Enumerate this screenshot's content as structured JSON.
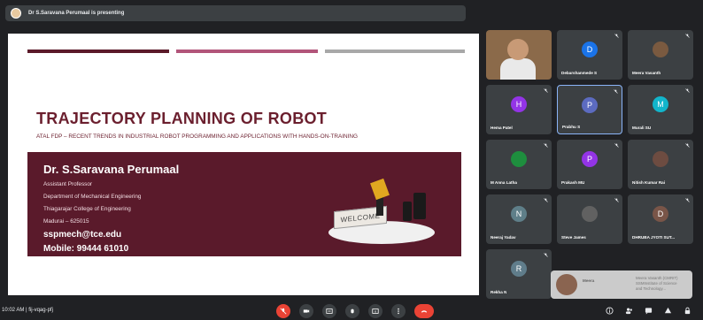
{
  "topbar": {
    "presenting_text": "Dr S.Saravana Perumaal is presenting"
  },
  "slide": {
    "bar_colors": [
      "#5b1a2a",
      "#b2557a",
      "#a8a8a8"
    ],
    "title": "TRAJECTORY PLANNING OF ROBOT",
    "subtitle": "ATAL FDP – RECENT TRENDS IN INDUSTRIAL ROBOT PROGRAMMING AND APPLICATIONS WITH HANDS-ON-TRAINING",
    "speaker": "Dr. S.Saravana Perumaal",
    "designation": "Assistant Professor",
    "department": "Department of Mechanical Engineering",
    "college": "Thiagarajar College of Engineering",
    "city": "Madurai – 625015",
    "email": "sspmech@tce.edu",
    "mobile": "Mobile: 99444 61010",
    "welcome_sign": "WELCOME",
    "panel_color": "#5a1a2b"
  },
  "participants": [
    {
      "name": "",
      "initial": "",
      "color": "",
      "video": true
    },
    {
      "name": "Debarshanmede S",
      "initial": "D",
      "color": "#1a73e8",
      "video": false
    },
    {
      "name": "Meera Vasanth",
      "initial": "",
      "color": "#7a5a40",
      "video": false
    },
    {
      "name": "Hema Patel",
      "initial": "H",
      "color": "#9334e6",
      "video": false
    },
    {
      "name": "Prabhu S",
      "initial": "P",
      "color": "#5c6bc0",
      "video": false
    },
    {
      "name": "Murali SU",
      "initial": "M",
      "color": "#12b5cb",
      "video": false
    },
    {
      "name": "M Anna Latha",
      "initial": "",
      "color": "#1e8e3e",
      "video": false
    },
    {
      "name": "Prakash MU",
      "initial": "P",
      "color": "#9334e6",
      "video": false
    },
    {
      "name": "Nitish Kumar Rai",
      "initial": "",
      "color": "#6d4c41",
      "video": false
    },
    {
      "name": "Neeraj Yadav",
      "initial": "N",
      "color": "#5f7f89",
      "video": false
    },
    {
      "name": "Steve James",
      "initial": "",
      "color": "#616161",
      "video": false
    },
    {
      "name": "DHRUBA JYOTI SUT...",
      "initial": "D",
      "color": "#795548",
      "video": false
    },
    {
      "name": "Rekha N",
      "initial": "R",
      "color": "#607d8b",
      "video": false
    }
  ],
  "toast": {
    "name": "Meera",
    "message": "Meera Vasanth (CMRIT) SSMInstitute of Science and Technology..."
  },
  "bottombar": {
    "meeting_info": "10:02 AM  |  fij-vqag-pfj"
  },
  "icons": {
    "controls": [
      "mic-off-icon",
      "camera-icon",
      "captions-icon",
      "raise-hand-icon",
      "present-icon",
      "more-icon",
      "end-call-icon"
    ],
    "right": [
      "info-icon",
      "people-icon",
      "chat-icon",
      "activities-icon",
      "lock-icon"
    ]
  },
  "colors": {
    "accent": "#8ab4f8",
    "danger": "#ea4335",
    "tile": "#3c4043",
    "bg": "#202124"
  }
}
